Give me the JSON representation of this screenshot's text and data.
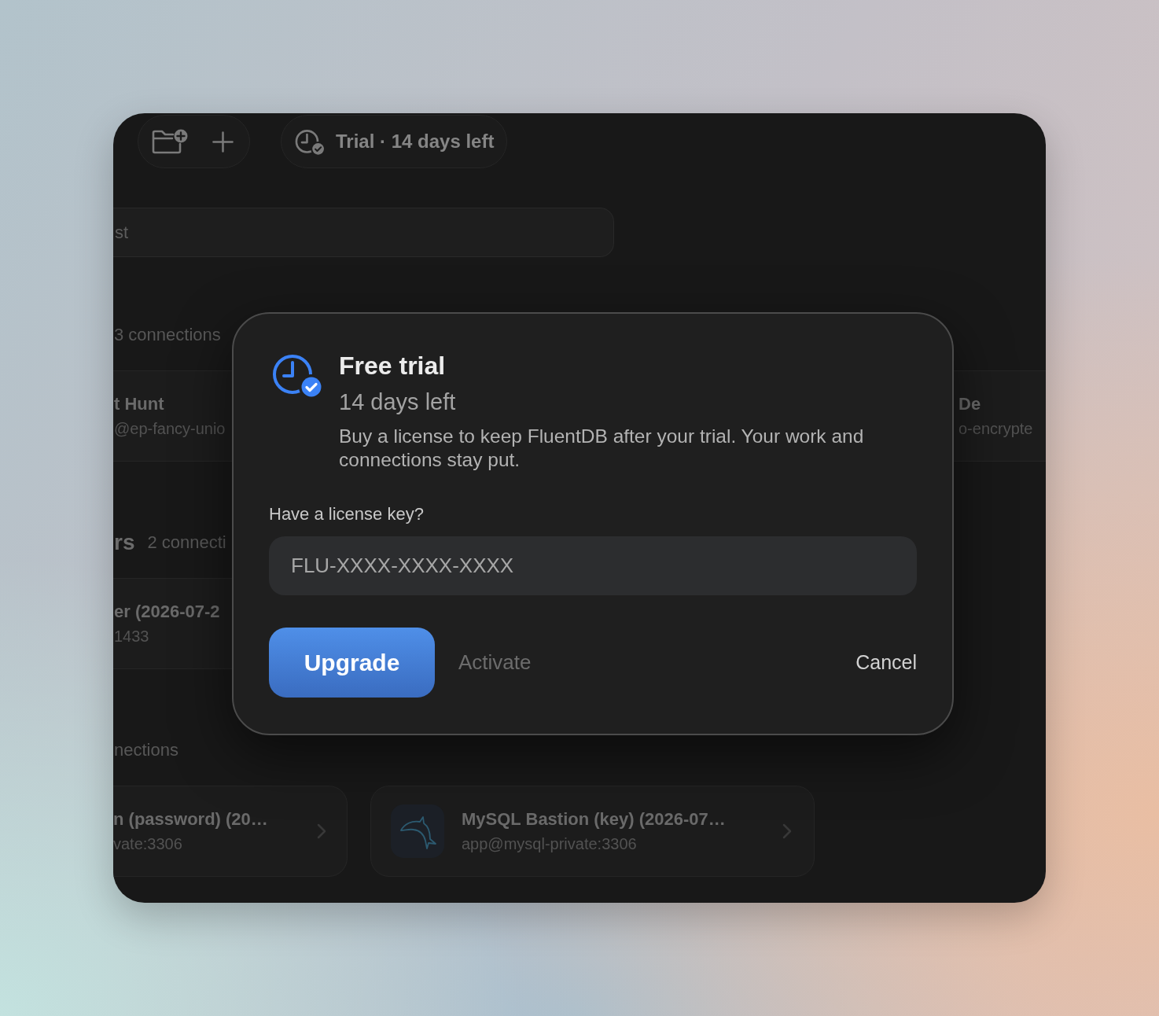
{
  "toolbar": {
    "trial": "Trial · 14 days left"
  },
  "search": {
    "placeholder": "st"
  },
  "sections": [
    {
      "count": "3 connections",
      "cards": [
        {
          "kind": "clipped-left",
          "name": "t Hunt",
          "address": "@ep-fancy-unio"
        },
        {
          "kind": "clipped-right",
          "name": "De",
          "address": "o-encrypte"
        }
      ]
    },
    {
      "title": "rs",
      "count": "2 connecti",
      "cards": [
        {
          "kind": "clipped-left",
          "name": "er (2026-07-2",
          "address": "1433"
        }
      ]
    },
    {
      "count": "nections",
      "cards": [
        {
          "kind": "chevron",
          "name": "n (password) (20…",
          "address": "vate:3306"
        },
        {
          "kind": "tile",
          "name": "MySQL Bastion (key) (2026-07…",
          "address": "app@mysql-private:3306"
        }
      ]
    }
  ],
  "dialog": {
    "title": "Free trial",
    "subtitle": "14 days left",
    "body": "Buy a license to keep FluentDB after your trial. Your work and connections stay put.",
    "license": {
      "label": "Have a license key?",
      "placeholder": "FLU-XXXX-XXXX-XXXX"
    },
    "buttons": [
      {
        "kind": "primary",
        "label": "Upgrade",
        "disabled": false
      },
      {
        "kind": "secondary",
        "label": "Activate",
        "disabled": true
      },
      {
        "kind": "cancel",
        "label": "Cancel",
        "disabled": false
      }
    ]
  }
}
